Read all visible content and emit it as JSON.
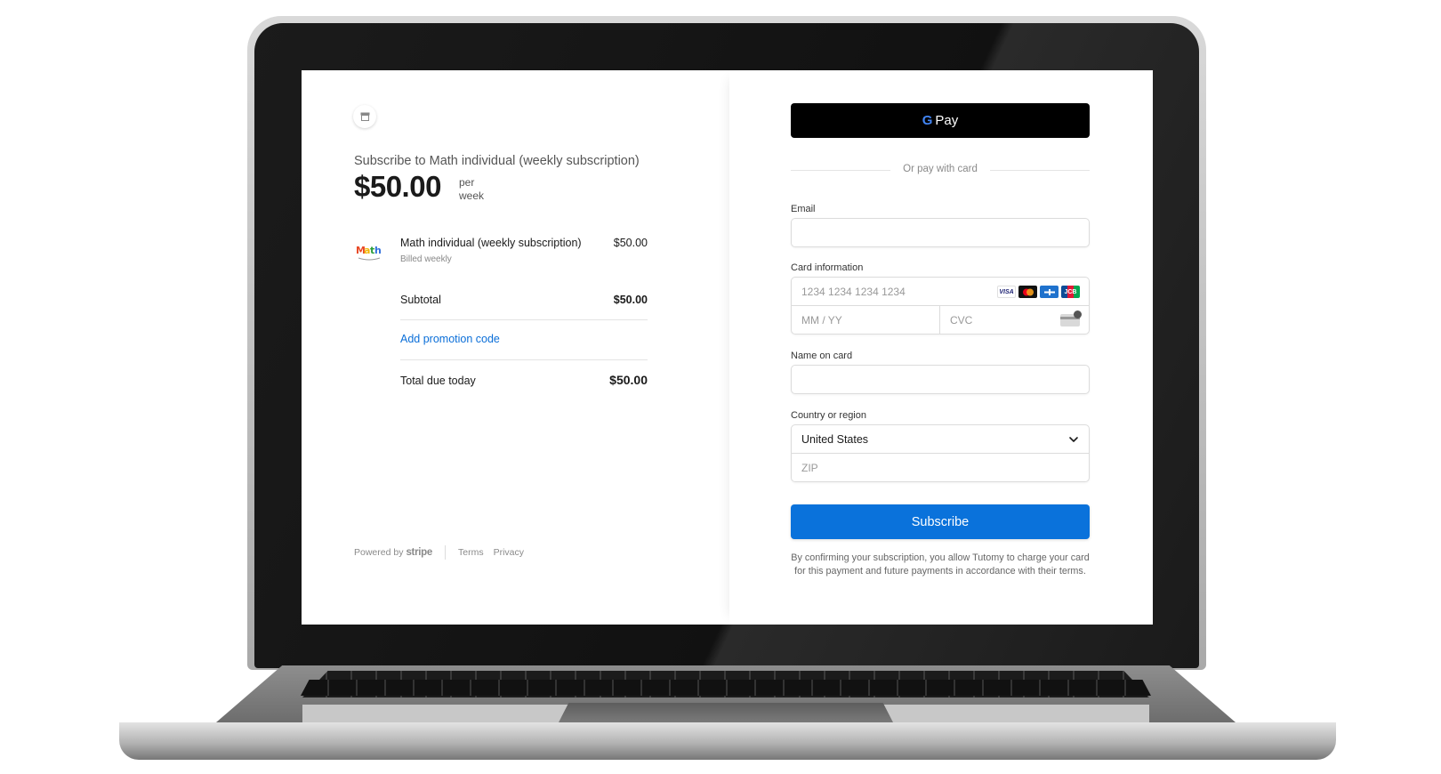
{
  "summary": {
    "title": "Subscribe to Math individual (weekly subscription)",
    "price": "$50.00",
    "period": "per week"
  },
  "line_item": {
    "name": "Math individual (weekly subscription)",
    "price": "$50.00",
    "billing": "Billed weekly",
    "logo_icon": "math-logo-icon"
  },
  "totals": {
    "subtotal_label": "Subtotal",
    "subtotal_value": "$50.00",
    "promo_link": "Add promotion code",
    "total_label": "Total due today",
    "total_value": "$50.00"
  },
  "footer": {
    "powered_by": "Powered by",
    "brand": "stripe",
    "terms": "Terms",
    "privacy": "Privacy"
  },
  "payment": {
    "gpay_g": "G",
    "gpay_label": "Pay",
    "divider_text": "Or pay with card",
    "email_label": "Email",
    "email_value": "",
    "card_label": "Card information",
    "card_number_placeholder": "1234 1234 1234 1234",
    "card_brands": [
      "VISA",
      "MC",
      "AMEX",
      "JCB"
    ],
    "expiry_placeholder": "MM / YY",
    "cvc_placeholder": "CVC",
    "name_label": "Name on card",
    "name_value": "",
    "country_label": "Country or region",
    "country_value": "United States",
    "zip_placeholder": "ZIP",
    "submit_label": "Subscribe",
    "legal_text": "By confirming your subscription, you allow Tutomy to charge your card for this payment and future payments in accordance with their terms."
  },
  "colors": {
    "accent": "#0a72db",
    "link": "#0a6ed8",
    "gpay_bg": "#000000"
  }
}
